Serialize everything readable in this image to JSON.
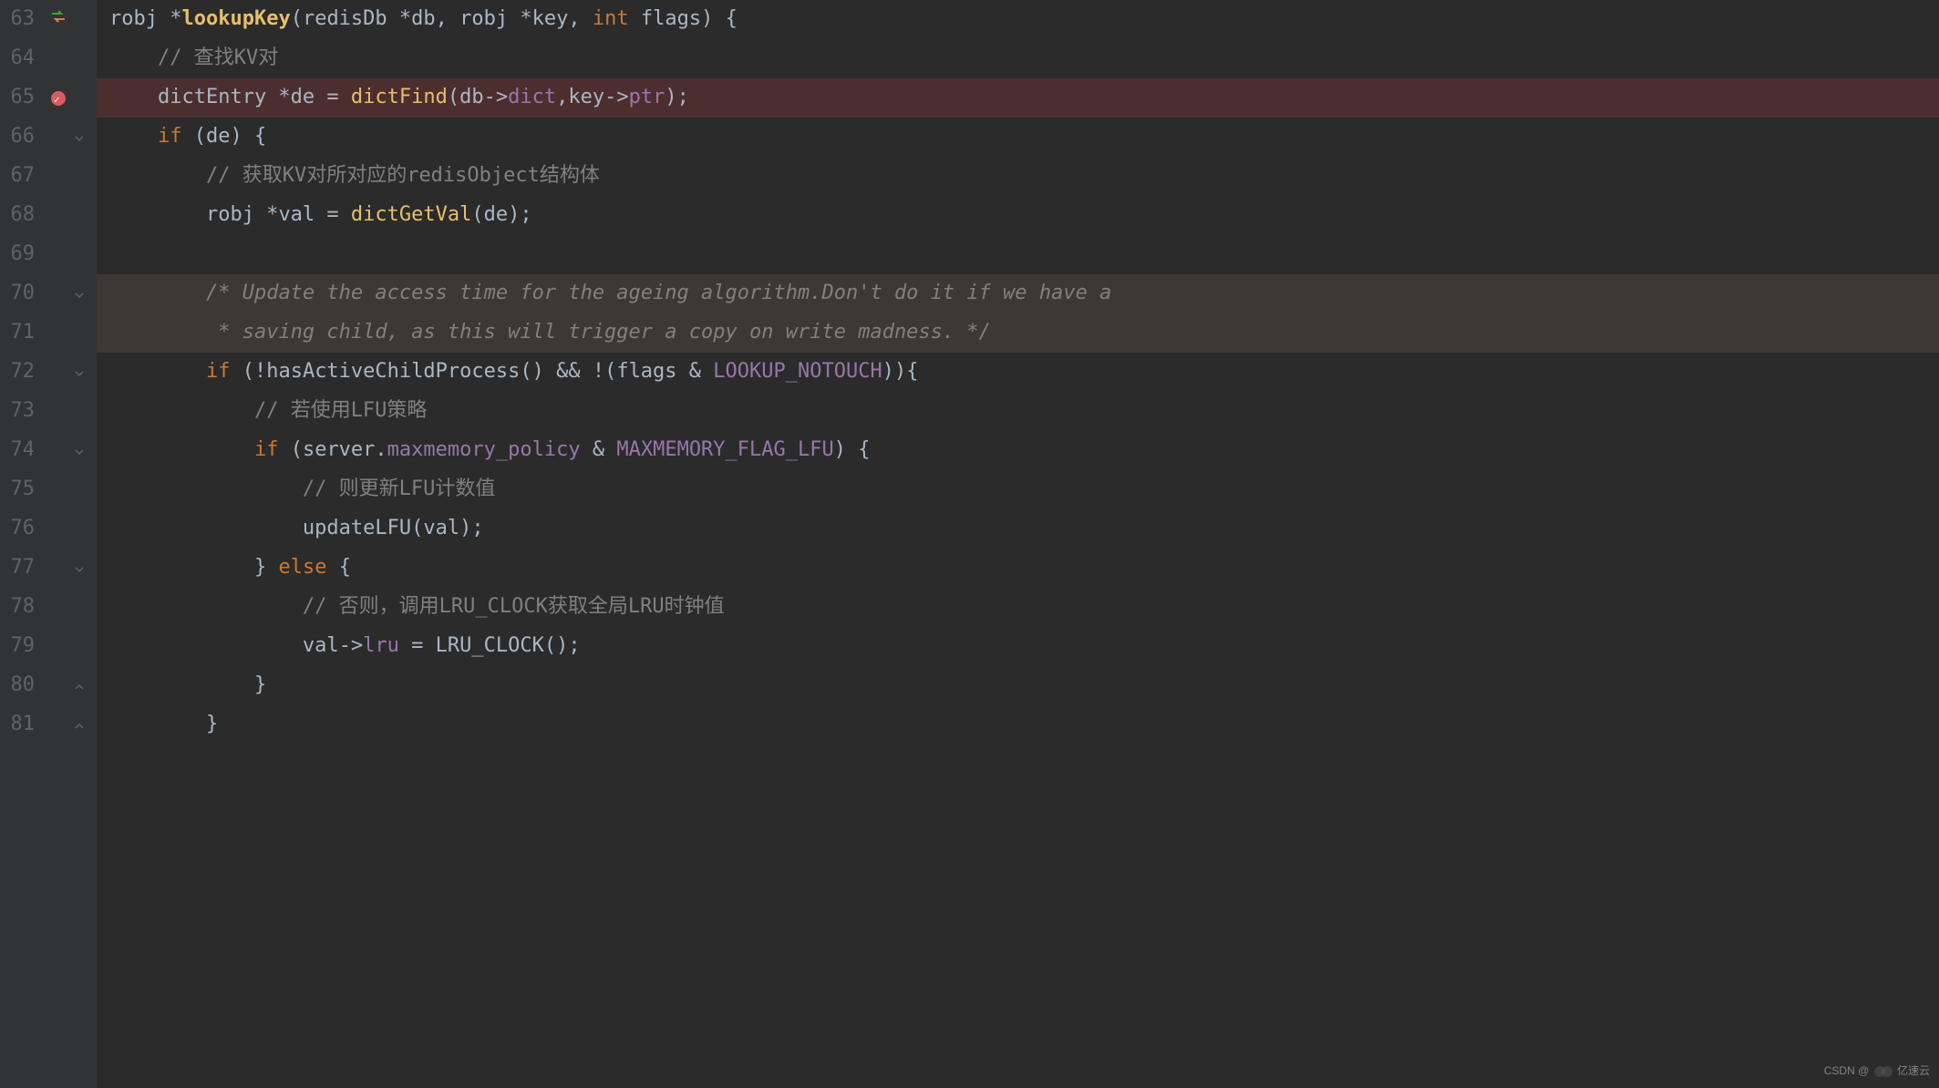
{
  "editor": {
    "startLine": 63,
    "lines": [
      {
        "num": 63,
        "icon": "swap",
        "segments": [
          {
            "t": "robj ",
            "c": "type"
          },
          {
            "t": "*",
            "c": "op"
          },
          {
            "t": "lookupKey",
            "c": "func"
          },
          {
            "t": "(redisDb ",
            "c": "type"
          },
          {
            "t": "*db",
            "c": "param"
          },
          {
            "t": ", robj ",
            "c": "type"
          },
          {
            "t": "*key",
            "c": "param"
          },
          {
            "t": ", ",
            "c": "op"
          },
          {
            "t": "int ",
            "c": "keyword"
          },
          {
            "t": "flags) {",
            "c": "param"
          }
        ]
      },
      {
        "num": 64,
        "indent": 1,
        "segments": [
          {
            "t": "// 查找KV对",
            "c": "comment"
          }
        ]
      },
      {
        "num": 65,
        "icon": "breakpoint",
        "highlight": true,
        "indent": 1,
        "segments": [
          {
            "t": "dictEntry *de = ",
            "c": "ident"
          },
          {
            "t": "dictFind",
            "c": "func-call"
          },
          {
            "t": "(db->",
            "c": "ident"
          },
          {
            "t": "dict",
            "c": "member"
          },
          {
            "t": ",key->",
            "c": "ident"
          },
          {
            "t": "ptr",
            "c": "member"
          },
          {
            "t": ");",
            "c": "ident"
          }
        ]
      },
      {
        "num": 66,
        "fold": "open",
        "indent": 1,
        "segments": [
          {
            "t": "if ",
            "c": "keyword"
          },
          {
            "t": "(de) {",
            "c": "ident"
          }
        ]
      },
      {
        "num": 67,
        "indent": 2,
        "segments": [
          {
            "t": "// 获取KV对所对应的redisObject结构体",
            "c": "comment"
          }
        ]
      },
      {
        "num": 68,
        "indent": 2,
        "segments": [
          {
            "t": "robj *val = ",
            "c": "ident"
          },
          {
            "t": "dictGetVal",
            "c": "func-call"
          },
          {
            "t": "(de);",
            "c": "ident"
          }
        ]
      },
      {
        "num": 69,
        "indent": 0,
        "segments": []
      },
      {
        "num": 70,
        "fold": "open",
        "collapsed": true,
        "indent": 2,
        "segments": [
          {
            "t": "/* Update the access time for the ageing algorithm.Don't do it if we have a",
            "c": "comment italic"
          }
        ]
      },
      {
        "num": 71,
        "collapsed": true,
        "indent": 2,
        "segments": [
          {
            "t": " * saving child, as this will trigger a copy on write madness. */",
            "c": "comment italic"
          }
        ]
      },
      {
        "num": 72,
        "fold": "open",
        "indent": 2,
        "segments": [
          {
            "t": "if ",
            "c": "keyword"
          },
          {
            "t": "(!hasActiveChildProcess() && !(flags & ",
            "c": "ident"
          },
          {
            "t": "LOOKUP_NOTOUCH",
            "c": "const"
          },
          {
            "t": ")){",
            "c": "ident"
          }
        ]
      },
      {
        "num": 73,
        "indent": 3,
        "segments": [
          {
            "t": "// 若使用LFU策略",
            "c": "comment"
          }
        ]
      },
      {
        "num": 74,
        "fold": "open",
        "indent": 3,
        "segments": [
          {
            "t": "if ",
            "c": "keyword"
          },
          {
            "t": "(server.",
            "c": "ident"
          },
          {
            "t": "maxmemory_policy",
            "c": "member"
          },
          {
            "t": " & ",
            "c": "ident"
          },
          {
            "t": "MAXMEMORY_FLAG_LFU",
            "c": "const"
          },
          {
            "t": ") {",
            "c": "ident"
          }
        ]
      },
      {
        "num": 75,
        "indent": 4,
        "segments": [
          {
            "t": "// 则更新LFU计数值",
            "c": "comment"
          }
        ]
      },
      {
        "num": 76,
        "indent": 4,
        "segments": [
          {
            "t": "updateLFU(val);",
            "c": "ident"
          }
        ]
      },
      {
        "num": 77,
        "fold": "open",
        "indent": 3,
        "segments": [
          {
            "t": "} ",
            "c": "ident"
          },
          {
            "t": "else ",
            "c": "keyword"
          },
          {
            "t": "{",
            "c": "ident"
          }
        ]
      },
      {
        "num": 78,
        "indent": 4,
        "segments": [
          {
            "t": "// 否则，调用LRU_CLOCK获取全局LRU时钟值",
            "c": "comment"
          }
        ]
      },
      {
        "num": 79,
        "indent": 4,
        "segments": [
          {
            "t": "val->",
            "c": "ident"
          },
          {
            "t": "lru",
            "c": "member"
          },
          {
            "t": " = LRU_CLOCK();",
            "c": "ident"
          }
        ]
      },
      {
        "num": 80,
        "fold": "close",
        "indent": 3,
        "segments": [
          {
            "t": "}",
            "c": "ident"
          }
        ]
      },
      {
        "num": 81,
        "fold": "close",
        "indent": 2,
        "segments": [
          {
            "t": "}",
            "c": "ident"
          }
        ]
      }
    ]
  },
  "watermark": {
    "text": "CSDN @",
    "brand": "亿速云"
  }
}
